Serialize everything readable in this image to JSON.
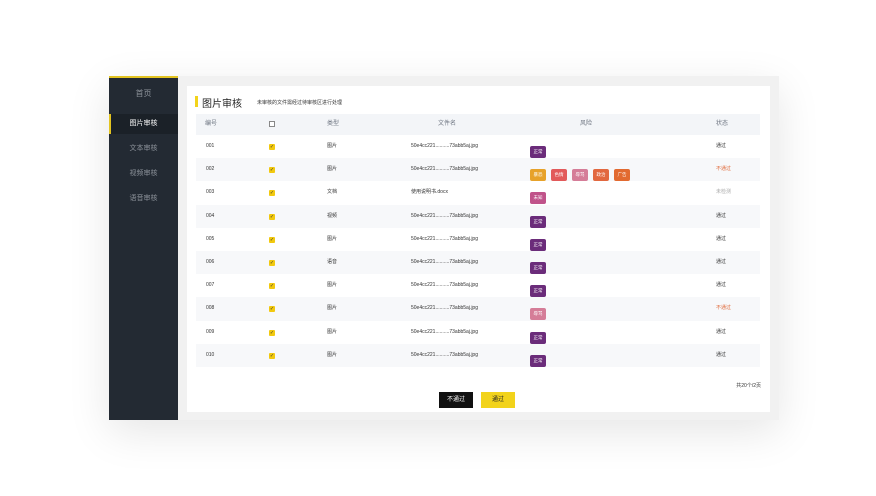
{
  "sidebar": {
    "home": "首页",
    "items": [
      {
        "label": "图片审核",
        "active": true
      },
      {
        "label": "文本审核",
        "active": false
      },
      {
        "label": "视频审核",
        "active": false
      },
      {
        "label": "语音审核",
        "active": false
      }
    ]
  },
  "header": {
    "title": "图片审核",
    "subtitle": "未审核的文件需经过待审核区进行处理"
  },
  "table": {
    "columns": [
      "编号",
      "",
      "类型",
      "文件名",
      "风险",
      "状态"
    ],
    "rows": [
      {
        "id": "001",
        "checked": true,
        "type": "图片",
        "filename": "50e4cc221..........73abb5aj.jpg",
        "risks": [
          {
            "label": "正常",
            "color": "#6b2c7a"
          }
        ],
        "status": "通过",
        "status_kind": "pass"
      },
      {
        "id": "002",
        "checked": true,
        "type": "图片",
        "filename": "50e4cc221..........73abb5aj.jpg",
        "risks": [
          {
            "label": "暴恐",
            "color": "#e7a22a"
          },
          {
            "label": "色情",
            "color": "#e25a5a"
          },
          {
            "label": "辱骂",
            "color": "#d57d98"
          },
          {
            "label": "政治",
            "color": "#e2683f"
          },
          {
            "label": "广告",
            "color": "#e26a30"
          }
        ],
        "status": "不通过",
        "status_kind": "fail"
      },
      {
        "id": "003",
        "checked": true,
        "type": "文档",
        "filename": "使用说明书.docx",
        "risks": [
          {
            "label": "未知",
            "color": "#c0538a"
          }
        ],
        "status": "未检测",
        "status_kind": "unknown"
      },
      {
        "id": "004",
        "checked": true,
        "type": "视频",
        "filename": "50e4cc221..........73abb5aj.jpg",
        "risks": [
          {
            "label": "正常",
            "color": "#6b2c7a"
          }
        ],
        "status": "通过",
        "status_kind": "pass"
      },
      {
        "id": "005",
        "checked": true,
        "type": "图片",
        "filename": "50e4cc221..........73abb5aj.jpg",
        "risks": [
          {
            "label": "正常",
            "color": "#6b2c7a"
          }
        ],
        "status": "通过",
        "status_kind": "pass"
      },
      {
        "id": "006",
        "checked": true,
        "type": "语音",
        "filename": "50e4cc221..........73abb5aj.jpg",
        "risks": [
          {
            "label": "正常",
            "color": "#6b2c7a"
          }
        ],
        "status": "通过",
        "status_kind": "pass"
      },
      {
        "id": "007",
        "checked": true,
        "type": "图片",
        "filename": "50e4cc221..........73abb5aj.jpg",
        "risks": [
          {
            "label": "正常",
            "color": "#6b2c7a"
          }
        ],
        "status": "通过",
        "status_kind": "pass"
      },
      {
        "id": "008",
        "checked": true,
        "type": "图片",
        "filename": "50e4cc221..........73abb5aj.jpg",
        "risks": [
          {
            "label": "辱骂",
            "color": "#d57d98"
          }
        ],
        "status": "不通过",
        "status_kind": "fail"
      },
      {
        "id": "009",
        "checked": true,
        "type": "图片",
        "filename": "50e4cc221..........73abb5aj.jpg",
        "risks": [
          {
            "label": "正常",
            "color": "#6b2c7a"
          }
        ],
        "status": "通过",
        "status_kind": "pass"
      },
      {
        "id": "010",
        "checked": true,
        "type": "图片",
        "filename": "50e4cc221..........73abb5aj.jpg",
        "risks": [
          {
            "label": "正常",
            "color": "#6b2c7a"
          }
        ],
        "status": "通过",
        "status_kind": "pass"
      }
    ]
  },
  "pagination": {
    "text": "共20个/2页"
  },
  "actions": {
    "fail_label": "不通过",
    "pass_label": "通过"
  },
  "colors": {
    "accent": "#f2d31b",
    "sidebar_bg": "#232a33",
    "fail_text": "#e06a3a"
  }
}
